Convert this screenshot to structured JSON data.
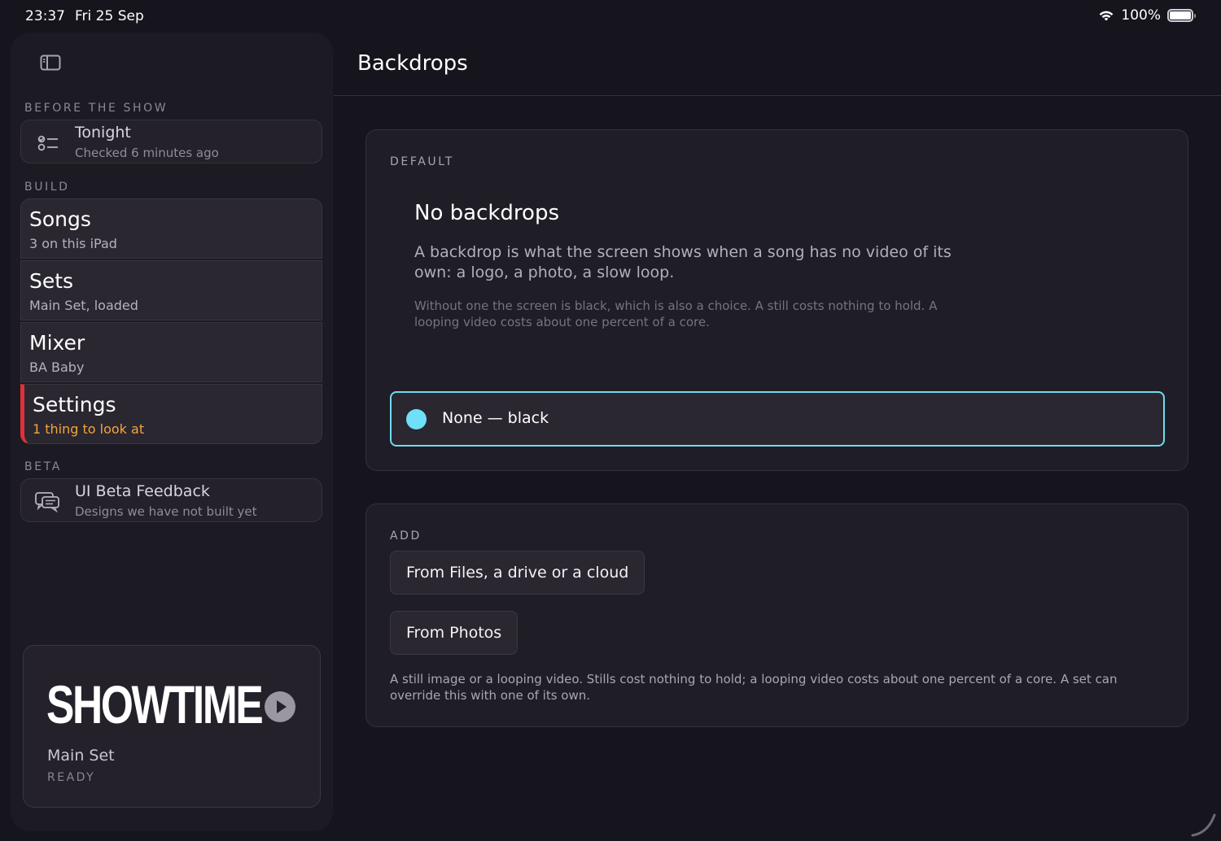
{
  "status_bar": {
    "time": "23:37",
    "date": "Fri 25 Sep",
    "battery": "100%"
  },
  "sidebar": {
    "before_show_title": "BEFORE THE SHOW",
    "tonight": {
      "title": "Tonight",
      "subtitle": "Checked 6 minutes ago"
    },
    "build_title": "BUILD",
    "nav": [
      {
        "title": "Songs",
        "subtitle": "3 on this iPad"
      },
      {
        "title": "Sets",
        "subtitle": "Main Set, loaded"
      },
      {
        "title": "Mixer",
        "subtitle": "BA Baby"
      },
      {
        "title": "Settings",
        "subtitle": "1 thing to look at"
      }
    ],
    "beta_title": "BETA",
    "beta": {
      "title": "UI Beta Feedback",
      "subtitle": "Designs we have not built yet"
    },
    "showtime": {
      "brand": "SHOWTIME",
      "set_name": "Main Set",
      "state": "READY"
    }
  },
  "main": {
    "title": "Backdrops",
    "default_panel": {
      "label": "DEFAULT",
      "empty_title": "No backdrops",
      "empty_body": "A backdrop is what the screen shows when a song has no video of its own: a logo, a photo, a slow loop.",
      "empty_note": "Without one the screen is black, which is also a choice. A still costs nothing to hold. A looping video costs about one percent of a core.",
      "option_label": "None — black"
    },
    "add_panel": {
      "label": "ADD",
      "files_button": "From Files, a drive or a cloud",
      "photos_button": "From Photos",
      "note": "A still image or a looping video. Stills cost nothing to hold; a looping video costs about one percent of a core. A set can override this with one of its own."
    }
  },
  "colors": {
    "accent": "#6ee0f7",
    "active_bar": "#e0303b",
    "warning_text": "#f3a53a"
  }
}
